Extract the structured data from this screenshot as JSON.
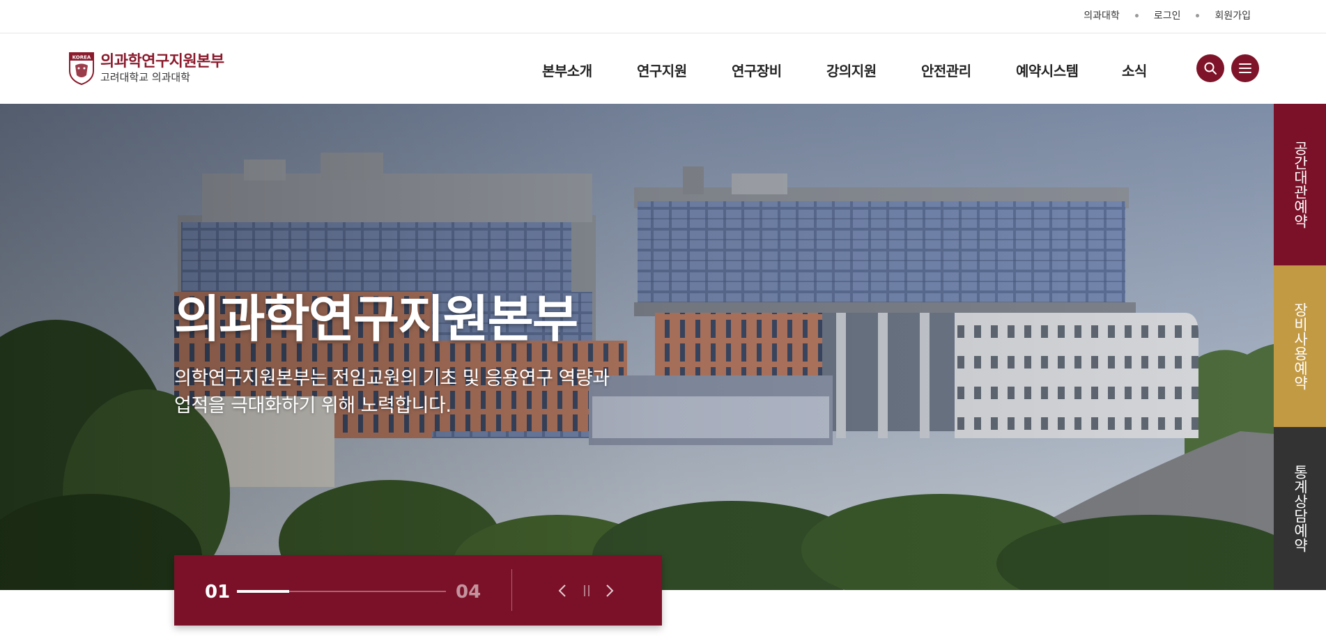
{
  "util": {
    "links": [
      "의과대학",
      "로그인",
      "회원가입"
    ]
  },
  "header": {
    "logo_title": "의과학연구지원본부",
    "logo_sub": "고려대학교 의과대학",
    "crest_text": "KOREA",
    "nav": [
      "본부소개",
      "연구지원",
      "연구장비",
      "강의지원",
      "안전관리",
      "예약시스템",
      "소식"
    ],
    "search_icon": "search-icon",
    "menu_icon": "hamburger-menu-icon"
  },
  "hero": {
    "title": "의과학연구지원본부",
    "description_line1": "의학연구지원본부는 전임교원의 기초 및 응용연구 역량과",
    "description_line2": "업적을 극대화하기 위해 노력합니다."
  },
  "slider": {
    "current": "01",
    "total": "04",
    "progress": 0.25
  },
  "quick_menu": {
    "items": [
      "공간대관예약",
      "장비사용예약",
      "통계상담예약"
    ]
  },
  "colors": {
    "brand": "#7b1128",
    "gold": "#c39a44",
    "dark": "#333333"
  }
}
